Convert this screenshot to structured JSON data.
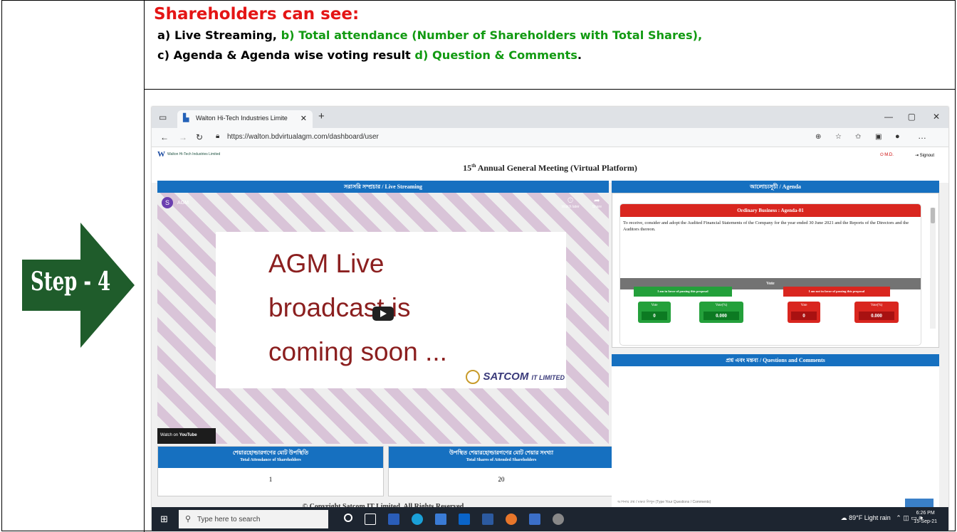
{
  "step": {
    "label": "Step - 4"
  },
  "header": {
    "title": "Shareholders can see:",
    "line1_a": "a) Live Streaming,",
    "line1_b": "b) Total attendance (Number of Shareholders with Total Shares),",
    "line2_a": "c) Agenda & Agenda wise voting result",
    "line2_b": "d) Question & Comments",
    "line2_end": "."
  },
  "browser": {
    "tab_title": "Walton Hi-Tech Industries Limite",
    "url": "https://walton.bdvirtualagm.com/dashboard/user"
  },
  "site": {
    "logo_text": "Walton Hi-Tech Industries Limited",
    "menu_md": "M.D.",
    "menu_signout": "Signout",
    "meeting_title_num": "15",
    "meeting_title_sup": "th",
    "meeting_title_rest": "Annual General Meeting (Virtual Platform)"
  },
  "live": {
    "header": "সরাসরি সম্প্রচার / Live Streaming",
    "channel_initial": "S",
    "channel_name": "AGM",
    "watch_later": "Watch later",
    "share": "Share",
    "slide_line1": "AGM Live",
    "slide_line2": "broadcast is",
    "slide_line3": "coming soon ...",
    "brand_main": "SATCOM",
    "brand_sub": "IT LIMITED",
    "watch_on": "Watch on",
    "youtube": "YouTube"
  },
  "stats": {
    "attendance_bn": "শেয়ারহোল্ডারগণের মোট উপস্থিতি",
    "attendance_en": "Total Attendance of Shareholders",
    "attendance_value": "1",
    "shares_bn": "উপস্থিত শেয়ারহোল্ডারগণের মোট শেয়ার সংখ্যা",
    "shares_en": "Total Shares of Attended Shareholders",
    "shares_value": "20"
  },
  "copyright": "© Copyright Satcom IT Limited. All Rights Reserved",
  "agenda": {
    "header": "আলোচ্যসূচী / Agenda",
    "card_title": "Ordinary Business : Agenda-01",
    "text": "To receive, consider and adopt the Audited Financial Statements of the Company for the year ended 30 June 2021 and the Reports of the Directors and the Auditors thereon.",
    "vote_header": "Vote",
    "favor_label": "I am in favor of passing this proposal",
    "against_label": "I am not in favor of passing this proposal",
    "vote_label": "Vote",
    "vote_pct_label": "Vote(%)",
    "favor_votes": "0",
    "favor_pct": "0.000",
    "against_votes": "0",
    "against_pct": "0.000"
  },
  "questions": {
    "header": "প্রশ্ন এবং মন্তব্য / Questions and Comments",
    "input_placeholder": "আপনার প্রশ্ন / মন্তব্য লিখুন (Type Your Questions / Comments)"
  },
  "taskbar": {
    "search_placeholder": "Type here to search",
    "weather": "89°F Light rain",
    "time": "6:26 PM",
    "date": "15-Sep-21"
  }
}
